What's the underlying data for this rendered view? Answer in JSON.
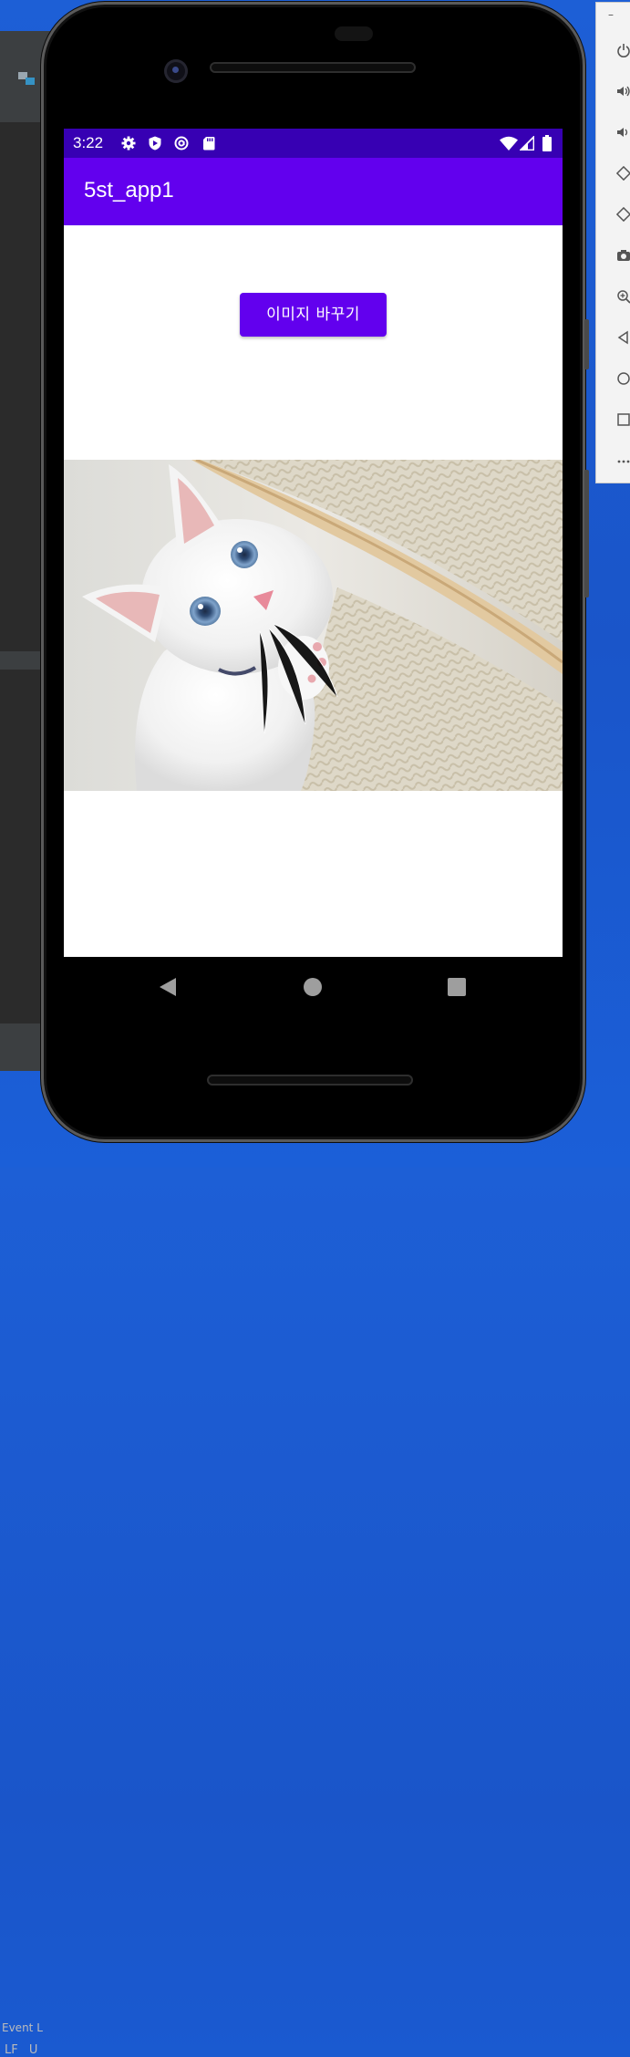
{
  "ide": {
    "event_log_label": "Event L",
    "status_left": "LF  U"
  },
  "emulator_toolbar": {
    "minimize": "–",
    "tools": [
      "power-icon",
      "volume-up-icon",
      "volume-down-icon",
      "rotate-left-icon",
      "rotate-right-icon",
      "camera-icon",
      "zoom-icon",
      "back-icon",
      "home-icon",
      "overview-icon",
      "more-icon"
    ]
  },
  "statusbar": {
    "time": "3:22",
    "icons": [
      "settings-icon",
      "shield-icon",
      "at-icon",
      "sd-card-icon",
      "wifi-icon",
      "signal-icon",
      "battery-icon"
    ]
  },
  "appbar": {
    "title": "5st_app1"
  },
  "main": {
    "change_image_button": "이미지 바꾸기",
    "image_subject": "white kitten with blue eyes beside a scratching post"
  },
  "colors": {
    "status_bar": "#3700b3",
    "app_bar": "#6200ee",
    "button": "#6200ee",
    "desktop": "#1a5ad0"
  },
  "navbar": {
    "buttons": [
      "back-icon",
      "home-icon",
      "recents-icon"
    ]
  }
}
